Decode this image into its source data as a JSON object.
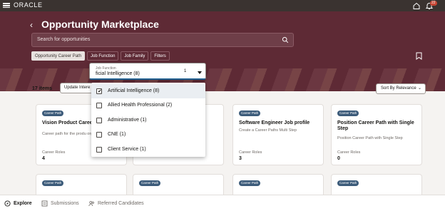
{
  "app": {
    "logo": "ORACLE",
    "notification_count": "22"
  },
  "page": {
    "title": "Opportunity Marketplace"
  },
  "search": {
    "placeholder": "Search for opportunities"
  },
  "filters": [
    {
      "label": "Opportunity Career Path"
    },
    {
      "label": "Job Function"
    },
    {
      "label": "Job Family"
    },
    {
      "label": "Filters"
    }
  ],
  "toolbar": {
    "items_count": "17 items",
    "update_label": "Update Intere",
    "sort_label": "Sort By Relevance"
  },
  "job_function": {
    "label": "Job Function",
    "value": "ficial Intelligence (8)",
    "count": "1",
    "options": [
      {
        "label": "Artificial Intelligence (8)",
        "checked": true
      },
      {
        "label": "Allied Health Professional (2)",
        "checked": false
      },
      {
        "label": "Administrative (1)",
        "checked": false
      },
      {
        "label": "CNE (1)",
        "checked": false
      },
      {
        "label": "Client Service (1)",
        "checked": false
      }
    ]
  },
  "cards": [
    {
      "tag": "Career Path",
      "title": "Vision Product Caree",
      "desc": "Career path for the produ organization.",
      "roles_label": "Career Roles",
      "roles_value": "4"
    },
    {
      "tag": "Career Path",
      "title": "",
      "desc": "",
      "roles_label": "",
      "roles_value": ""
    },
    {
      "tag": "Career Path",
      "title": "Software Engineer Job profile",
      "desc": "Create a Career Paths Multi Step",
      "roles_label": "Career Roles",
      "roles_value": "3"
    },
    {
      "tag": "Career Path",
      "title": "Position Career Path with Single Step",
      "desc": "Position Career Path with Single Step",
      "roles_label": "Career Roles",
      "roles_value": "0"
    },
    {
      "tag": "Career Path"
    },
    {
      "tag": "Career Path"
    },
    {
      "tag": "Career Path"
    },
    {
      "tag": "Career Path"
    }
  ],
  "bottom_nav": [
    {
      "label": "Explore",
      "icon": "compass-icon",
      "active": true
    },
    {
      "label": "Submissions",
      "icon": "list-icon",
      "active": false
    },
    {
      "label": "Referred Candidates",
      "icon": "users-icon",
      "active": false
    }
  ]
}
